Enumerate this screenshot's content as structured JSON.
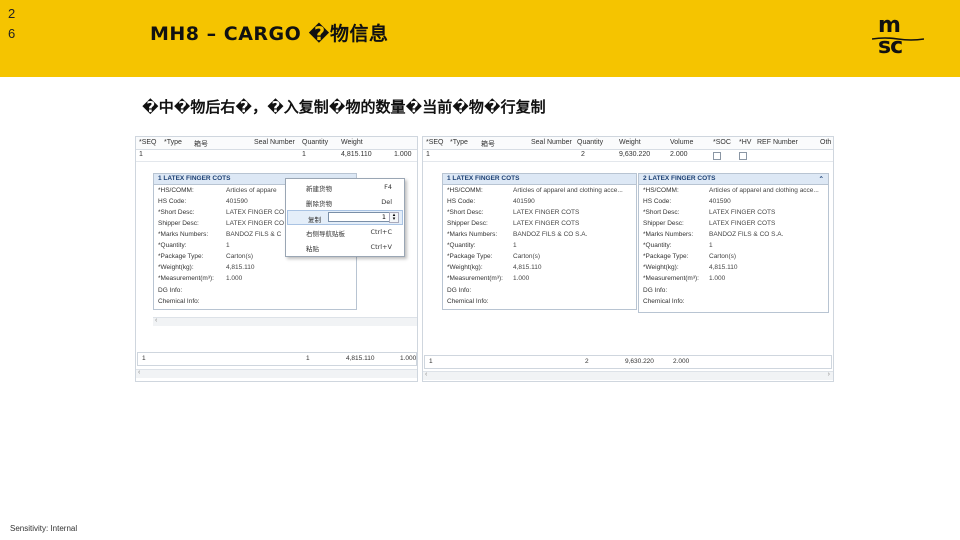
{
  "slide": {
    "page_number": "2\n6",
    "title": "MH8 – CARGO �物信息",
    "subtitle": "�中�物后右�，�入复制�物的数量�当前�物�行复制",
    "footer": "Sensitivity: Internal",
    "logo": {
      "line1": "m",
      "line2": "sc"
    }
  },
  "left": {
    "columns": [
      "*SEQ",
      "*Type",
      "箱号",
      "Seal Number",
      "Quantity",
      "Weight"
    ],
    "row": {
      "seq": "1",
      "quantity": "1",
      "weight": "4,815.110",
      "extra": "1.000"
    },
    "panel": {
      "title": "1  LATEX FINGER COTS",
      "fields": [
        {
          "k": "*HS/COMM:",
          "v": "Articles of appare"
        },
        {
          "k": "HS Code:",
          "v": "401590"
        },
        {
          "k": "*Short Desc:",
          "v": "LATEX FINGER CO"
        },
        {
          "k": "Shipper Desc:",
          "v": "LATEX FINGER CO"
        },
        {
          "k": "*Marks Numbers:",
          "v": "BANDOZ FILS & C"
        },
        {
          "k": "*Quantity:",
          "v": "1"
        },
        {
          "k": "*Package Type:",
          "v": "Carton(s)"
        },
        {
          "k": "*Weight(kg):",
          "v": "4,815.110"
        },
        {
          "k": "*Measurement(m³):",
          "v": "1.000"
        }
      ]
    },
    "below": [
      "DG Info:",
      "Chemical Info:"
    ],
    "footer_row": {
      "seq": "1",
      "quantity": "1",
      "weight": "4,815.110",
      "extra": "1.000"
    }
  },
  "menu": {
    "items": [
      {
        "label": "新建货物",
        "shortcut": "F4"
      },
      {
        "label": "删除货物",
        "shortcut": "Del"
      },
      {
        "label": "复制",
        "shortcut": "1"
      },
      {
        "label": "右侧导航贴板",
        "shortcut": "Ctrl+C"
      },
      {
        "label": "粘贴",
        "shortcut": "Ctrl+V"
      }
    ]
  },
  "right": {
    "columns": [
      "*SEQ",
      "*Type",
      "箱号",
      "Seal Number",
      "Quantity",
      "Weight",
      "Volume",
      "*SOC",
      "*HV",
      "REF Number",
      "Oth"
    ],
    "row": {
      "seq": "1",
      "quantity": "2",
      "weight": "9,630.220",
      "volume": "2.000"
    },
    "panels": [
      {
        "title": "1  LATEX FINGER COTS",
        "fields": [
          {
            "k": "*HS/COMM:",
            "v": "Articles of apparel and clothing acce..."
          },
          {
            "k": "HS Code:",
            "v": "401590"
          },
          {
            "k": "*Short Desc:",
            "v": "LATEX FINGER COTS"
          },
          {
            "k": "Shipper Desc:",
            "v": "LATEX FINGER COTS"
          },
          {
            "k": "*Marks Numbers:",
            "v": "BANDOZ FILS & CO S.A."
          },
          {
            "k": "*Quantity:",
            "v": "1"
          },
          {
            "k": "*Package Type:",
            "v": "Carton(s)"
          },
          {
            "k": "*Weight(kg):",
            "v": "4,815.110"
          },
          {
            "k": "*Measurement(m³):",
            "v": "1.000"
          }
        ]
      },
      {
        "title": "2  LATEX FINGER COTS",
        "fields": [
          {
            "k": "*HS/COMM:",
            "v": "Articles of apparel and clothing acce..."
          },
          {
            "k": "HS Code:",
            "v": "401590"
          },
          {
            "k": "*Short Desc:",
            "v": "LATEX FINGER COTS"
          },
          {
            "k": "Shipper Desc:",
            "v": "LATEX FINGER COTS"
          },
          {
            "k": "*Marks Numbers:",
            "v": "BANDOZ FILS & CO S.A."
          },
          {
            "k": "*Quantity:",
            "v": "1"
          },
          {
            "k": "*Package Type:",
            "v": "Carton(s)"
          },
          {
            "k": "*Weight(kg):",
            "v": "4,815.110"
          },
          {
            "k": "*Measurement(m³):",
            "v": "1.000"
          }
        ]
      }
    ],
    "below": [
      "DG Info:",
      "Chemical Info:"
    ],
    "footer_row": {
      "seq": "1",
      "quantity": "2",
      "weight": "9,630.220",
      "extra": "2.000"
    }
  }
}
